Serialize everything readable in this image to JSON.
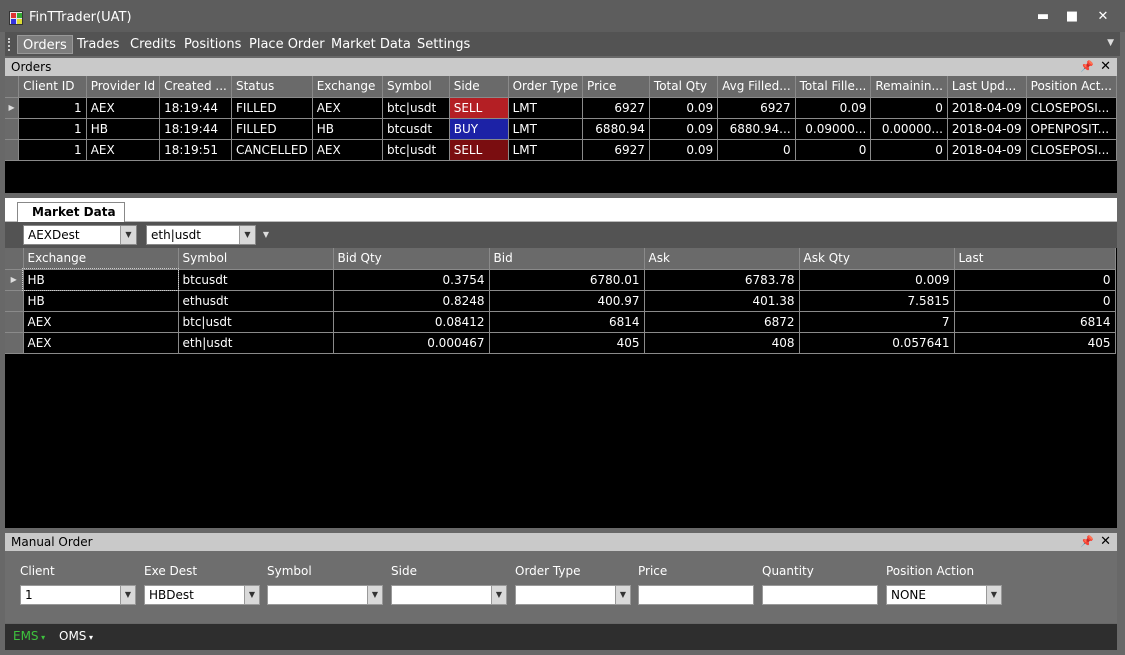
{
  "window": {
    "title": "FinTTrader(UAT)",
    "min_label": "▬",
    "max_label": "■",
    "close_label": "✕"
  },
  "menu": {
    "items": [
      "Orders",
      "Trades",
      "Credits",
      "Positions",
      "Place Order",
      "Market Data",
      "Settings"
    ],
    "more_label": "▼"
  },
  "orders": {
    "title": "Orders",
    "columns": [
      "Client ID",
      "Provider Id",
      "Created ...",
      "Status",
      "Exchange",
      "Symbol",
      "Side",
      "Order Type",
      "Price",
      "Total Qty",
      "Avg Filled...",
      "Total Fille...",
      "Remainin...",
      "Last Upd...",
      "Position Act..."
    ],
    "rows": [
      {
        "client_id": "1",
        "provider_id": "AEX",
        "created": "18:19:44",
        "status": "FILLED",
        "exchange": "AEX",
        "symbol": "btc|usdt",
        "side": "SELL",
        "order_type": "LMT",
        "price": "6927",
        "total_qty": "0.09",
        "avg_filled": "6927",
        "total_filled": "0.09",
        "remaining": "0",
        "last_update": "2018-04-09",
        "position_action": "CLOSEPOSI..."
      },
      {
        "client_id": "1",
        "provider_id": "HB",
        "created": "18:19:44",
        "status": "FILLED",
        "exchange": "HB",
        "symbol": "btcusdt",
        "side": "BUY",
        "order_type": "LMT",
        "price": "6880.94",
        "total_qty": "0.09",
        "avg_filled": "6880.94...",
        "total_filled": "0.09000...",
        "remaining": "0.00000...",
        "last_update": "2018-04-09",
        "position_action": "OPENPOSIT..."
      },
      {
        "client_id": "1",
        "provider_id": "AEX",
        "created": "18:19:51",
        "status": "CANCELLED",
        "exchange": "AEX",
        "symbol": "btc|usdt",
        "side": "SELL",
        "order_type": "LMT",
        "price": "6927",
        "total_qty": "0.09",
        "avg_filled": "0",
        "total_filled": "0",
        "remaining": "0",
        "last_update": "2018-04-09",
        "position_action": "CLOSEPOSI..."
      }
    ]
  },
  "colors": {
    "sell_filled": "#b41f24",
    "buy": "#1c22a6",
    "sell_cancelled": "#7a0d10"
  },
  "market": {
    "tab_label": "Market Data",
    "dest_filter": "AEXDest",
    "symbol_filter": "eth|usdt",
    "columns": [
      "Exchange",
      "Symbol",
      "Bid Qty",
      "Bid",
      "Ask",
      "Ask Qty",
      "Last"
    ],
    "rows": [
      {
        "exchange": "HB",
        "symbol": "btcusdt",
        "bid_qty": "0.3754",
        "bid": "6780.01",
        "ask": "6783.78",
        "ask_qty": "0.009",
        "last": "0"
      },
      {
        "exchange": "HB",
        "symbol": "ethusdt",
        "bid_qty": "0.8248",
        "bid": "400.97",
        "ask": "401.38",
        "ask_qty": "7.5815",
        "last": "0"
      },
      {
        "exchange": "AEX",
        "symbol": "btc|usdt",
        "bid_qty": "0.08412",
        "bid": "6814",
        "ask": "6872",
        "ask_qty": "7",
        "last": "6814"
      },
      {
        "exchange": "AEX",
        "symbol": "eth|usdt",
        "bid_qty": "0.000467",
        "bid": "405",
        "ask": "408",
        "ask_qty": "0.057641",
        "last": "405"
      }
    ]
  },
  "manual_order": {
    "title": "Manual Order",
    "client_label": "Client",
    "client_value": "1",
    "exe_dest_label": "Exe Dest",
    "exe_dest_value": "HBDest",
    "symbol_label": "Symbol",
    "symbol_value": "",
    "side_label": "Side",
    "side_value": "",
    "order_type_label": "Order Type",
    "order_type_value": "",
    "price_label": "Price",
    "price_value": "",
    "quantity_label": "Quantity",
    "quantity_value": "",
    "position_action_label": "Position Action",
    "position_action_value": "NONE"
  },
  "status": {
    "ems_label": "EMS",
    "oms_label": "OMS"
  }
}
